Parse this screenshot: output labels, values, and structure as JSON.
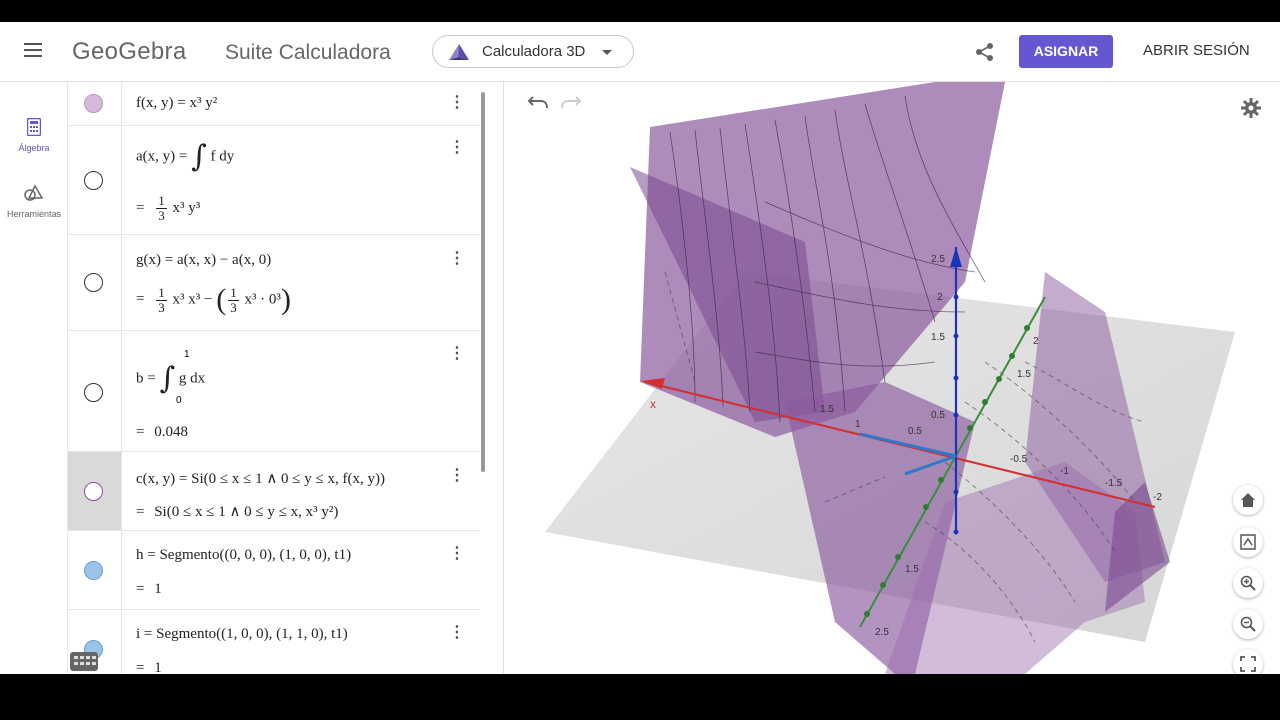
{
  "header": {
    "logo": "GeoGebra",
    "suite_title": "Suite Calculadora",
    "app_select": "Calculadora 3D",
    "assign_label": "ASIGNAR",
    "login_label": "ABRIR SESIÓN"
  },
  "rail": {
    "items": [
      {
        "label": "Álgebra",
        "icon": "calculator-icon",
        "active": true
      },
      {
        "label": "Herramientas",
        "icon": "tools-icon",
        "active": false
      }
    ]
  },
  "algebra": {
    "rows": [
      {
        "id": "f",
        "input": "f(x, y)  =  x³ y²",
        "marble": "purple"
      },
      {
        "id": "a",
        "input_prefix": "a(x, y)  =",
        "input_suffix": "f dy",
        "output_coef": {
          "num": "1",
          "den": "3"
        },
        "output_rest": "x³ y³",
        "marble": "empty"
      },
      {
        "id": "g",
        "input": "g(x)  =  a(x,  x) − a(x,  0)",
        "output_parts": [
          "x³ x³ −",
          "x³ · 0³"
        ],
        "output_coef": {
          "num": "1",
          "den": "3"
        },
        "marble": "empty"
      },
      {
        "id": "b",
        "input_prefix": "b  =",
        "input_suffix": "g dx",
        "upper": "1",
        "lower": "0",
        "output": "0.048",
        "marble": "empty"
      },
      {
        "id": "c",
        "input": "c(x, y)  =  Si(0 ≤ x ≤ 1 ∧ 0 ≤ y ≤ x, f(x,  y))",
        "output": "Si(0 ≤ x ≤ 1 ∧ 0 ≤ y ≤ x, x³ y²)",
        "marble": "purple-outline",
        "selected": true
      },
      {
        "id": "h",
        "input": "h  =  Segmento((0,  0,  0), (1,  0,  0), t1)",
        "output": "1",
        "marble": "blue"
      },
      {
        "id": "i",
        "input": "i  =  Segmento((1,  0,  0), (1,  1,  0), t1)",
        "output": "1",
        "marble": "blue"
      }
    ],
    "equals": "="
  },
  "graphics": {
    "axis_x_label": "x",
    "x_ticks": [
      "0.5",
      "1",
      "1.5",
      "-0.5",
      "-1",
      "-1.5",
      "-2"
    ],
    "y_ticks": [
      "2",
      "1.5",
      "1",
      "0.5",
      "1.5",
      "2",
      "2.5"
    ],
    "z_ticks": [
      "2.5",
      "2",
      "1.5",
      "1",
      "0.5",
      "-0.5"
    ],
    "colors": {
      "surface": "#8a5a9e",
      "x_axis": "#d32f2f",
      "y_axis": "#388e3c",
      "z_axis": "#1a33b8",
      "segments": "#2e77c9"
    }
  }
}
